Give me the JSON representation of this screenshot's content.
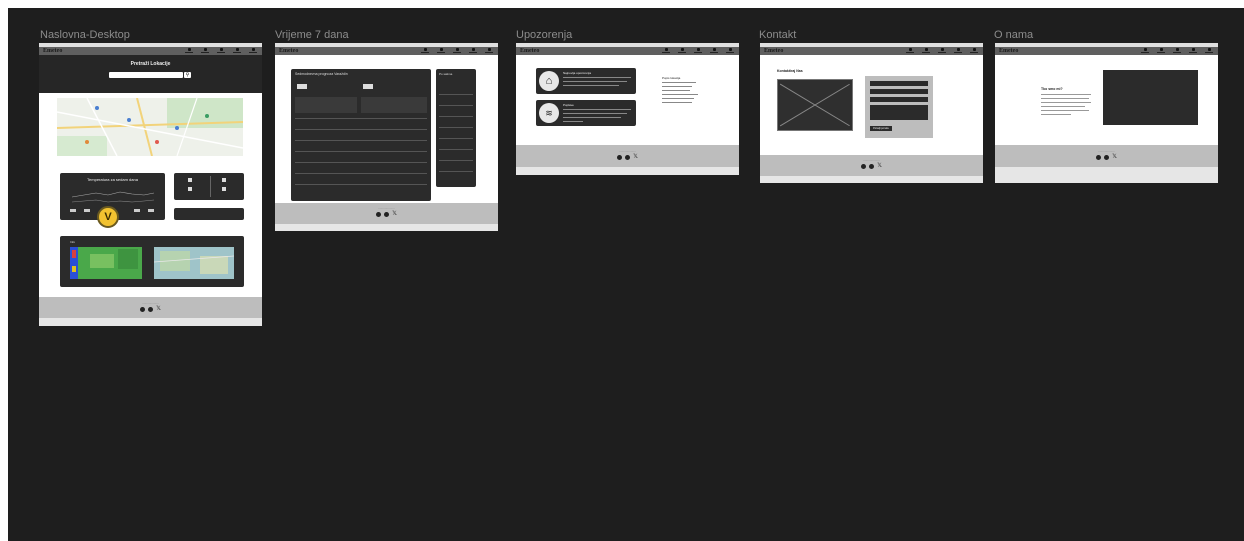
{
  "frames": [
    {
      "title": "Naslovna-Desktop"
    },
    {
      "title": "Vrijeme 7 dana"
    },
    {
      "title": "Upozorenja"
    },
    {
      "title": "Kontakt"
    },
    {
      "title": "O nama"
    }
  ],
  "brand": "Emeteo",
  "home": {
    "search_title": "Pretraži Lokacije",
    "temp_card_title": "Temperatura za sedam dana",
    "badge_letter": "V",
    "radar_title": "Info"
  },
  "forecast": {
    "panel_title": "Sedmodnevna prognoza Varaždin",
    "side_title": "Po satima"
  },
  "warnings": {
    "card1_title": "Najnovija upozorenja",
    "card2_title": "Poplave",
    "list_title": "Popis lokacija"
  },
  "contact": {
    "title": "Kontaktiraj Nas",
    "submit": "Pošalji poruku"
  },
  "about": {
    "title": "Tko smo mi?"
  },
  "colors": {
    "canvas": "#1e1e1e",
    "badge": "#f2c230",
    "nav": "#5f5f5f",
    "footer": "#bdbdbd"
  }
}
